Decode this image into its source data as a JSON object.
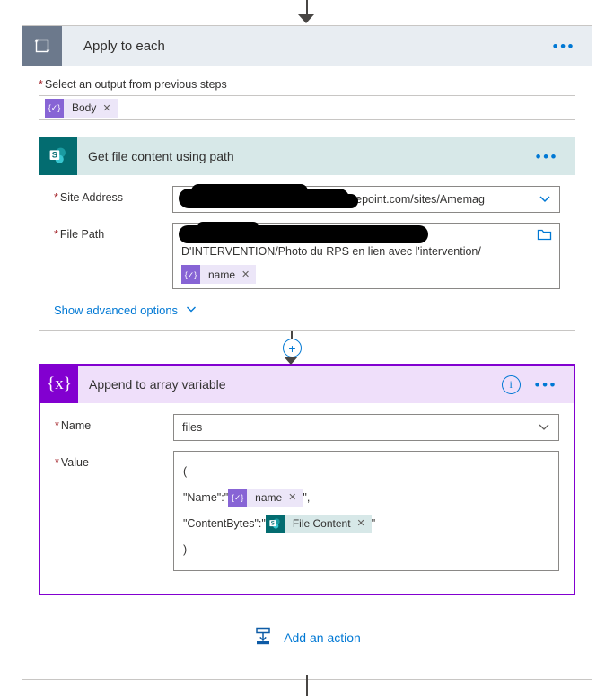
{
  "top_connector": {
    "icon": "arrow-down-icon"
  },
  "loop": {
    "icon": "loop-icon",
    "title": "Apply to each",
    "menu": "•••",
    "output_field": {
      "label": "Select an output from previous steps",
      "required_marker": "*",
      "token": {
        "icon": "expression-icon",
        "glyph": "{✓}",
        "label": "Body",
        "remove": "✕"
      }
    }
  },
  "sharepoint_card": {
    "icon": "sharepoint-icon",
    "title": "Get file content using path",
    "menu": "•••",
    "site_address": {
      "label": "Site Address",
      "required_marker": "*",
      "value": "arepoint.com/sites/Amemag",
      "affix_icon": "chevron-down-icon"
    },
    "file_path": {
      "label": "File Path",
      "required_marker": "*",
      "value_line": "D'INTERVENTION/Photo du RPS en lien avec l'intervention/",
      "token": {
        "icon": "expression-icon",
        "glyph": "{✓}",
        "label": "name",
        "remove": "✕"
      },
      "affix_icon": "folder-open-icon"
    },
    "advanced_options": {
      "label": "Show advanced options",
      "icon": "chevron-down-icon"
    }
  },
  "insert_button": {
    "icon": "plus-icon",
    "glyph": "+"
  },
  "variable_card": {
    "icon": "variable-icon",
    "glyph": "{x}",
    "title": "Append to array variable",
    "info_icon": "info-icon",
    "info_glyph": "i",
    "menu": "•••",
    "name_field": {
      "label": "Name",
      "required_marker": "*",
      "value": "files",
      "affix_icon": "chevron-down-icon"
    },
    "value_field": {
      "label": "Value",
      "required_marker": "*",
      "line1": "(",
      "line2_prefix": "\"Name\":\"",
      "line2_token": {
        "icon": "expression-icon",
        "glyph": "{✓}",
        "label": "name",
        "remove": "✕"
      },
      "line2_suffix": "\",",
      "line3_prefix": "\"ContentBytes\":\"",
      "line3_token": {
        "icon": "sharepoint-icon",
        "label": "File Content",
        "remove": "✕"
      },
      "line3_suffix": "\"",
      "line4": ")"
    }
  },
  "add_action": {
    "icon": "add-action-icon",
    "label": "Add an action"
  },
  "colors": {
    "loop_header": "#e8edf2",
    "loop_icon_bg": "#6c798c",
    "sharepoint_teal": "#036c70",
    "sharepoint_header": "#d7e8e8",
    "variable_purple": "#8200d0",
    "variable_header": "#efdffa",
    "expression_purple": "#8764d5",
    "accent_blue": "#0078d4",
    "required_red": "#a4262c",
    "connector_gray": "#484644"
  }
}
